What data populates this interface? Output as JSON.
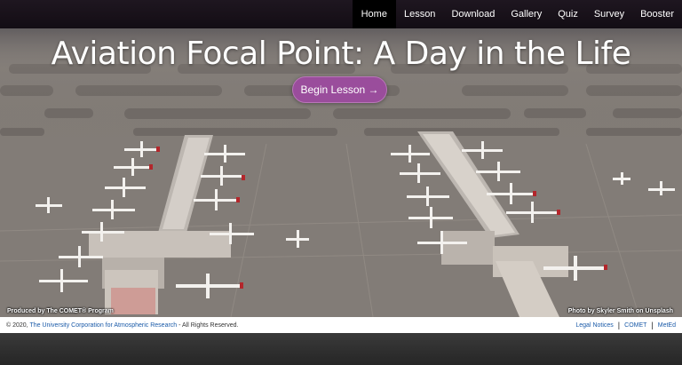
{
  "nav": {
    "items": [
      {
        "label": "Home",
        "active": true
      },
      {
        "label": "Lesson",
        "active": false
      },
      {
        "label": "Download",
        "active": false
      },
      {
        "label": "Gallery",
        "active": false
      },
      {
        "label": "Quiz",
        "active": false
      },
      {
        "label": "Survey",
        "active": false
      },
      {
        "label": "Booster",
        "active": false
      }
    ]
  },
  "hero": {
    "title": "Aviation Focal Point: A Day in the Life",
    "cta_label": "Begin Lesson →",
    "cta_color": "#9a4d9c",
    "credit_left": "Produced by The COMET® Program",
    "credit_right": "Photo by Skyler Smith on Unsplash"
  },
  "footer": {
    "copyright_prefix": "© 2020, ",
    "org_link": "The University Corporation for Atmospheric Research",
    "copyright_suffix": " - All Rights Reserved.",
    "links": [
      "Legal Notices",
      "COMET",
      "MetEd"
    ],
    "link_color": "#1a5aa8"
  }
}
